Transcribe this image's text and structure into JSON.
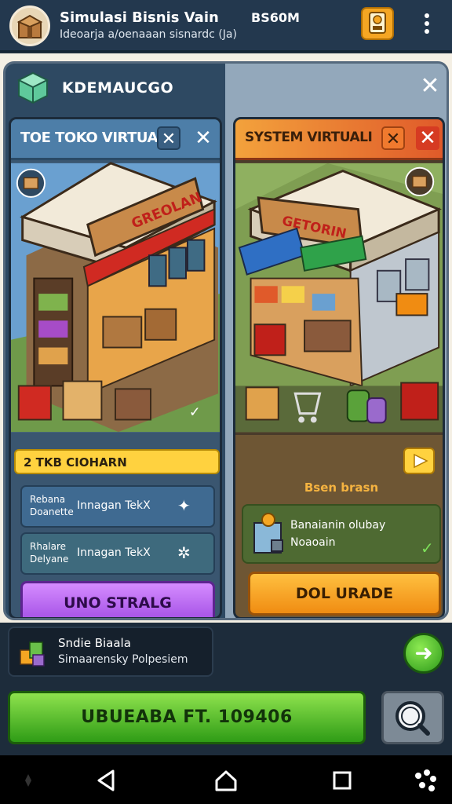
{
  "header": {
    "title": "Simulasi Bisnis Vain",
    "code": "BS60M",
    "subtitle": "Ideoarja a/oenaaan  sisnardc (Ja)",
    "app_icon": "store-box-icon",
    "profile_icon": "badge-icon",
    "menu_icon": "kebab-menu-icon"
  },
  "panel": {
    "title": "KDEMAUCGO",
    "icon": "cube-icon",
    "close_label": "✕"
  },
  "left_card": {
    "title": "TOE TOKO VIRTUAL",
    "close_box_label": "✕",
    "close_label": "✕",
    "sign_text": "GREOLAN",
    "banner": "2 TKB CIOHARN",
    "options": [
      {
        "label_line1": "Rebana",
        "label_line2": "Doanette",
        "text": "Innagan TekX",
        "icon": "sparkle-icon",
        "icon_glyph": "✦"
      },
      {
        "label_line1": "Rhalare",
        "label_line2": "Delyane",
        "text": "Innagan TekX",
        "icon": "star-icon",
        "icon_glyph": "✲"
      }
    ],
    "button": "UNO STRALG"
  },
  "right_card": {
    "title": "SYSTEM VIRTUALI",
    "close_box_label": "✕",
    "close_label": "✕",
    "sign_text": "GETORIN",
    "subtitle": "Bsen brasn",
    "info_line1": "Banaianin olubay",
    "info_line2": "Noaoain",
    "check": "✓",
    "button": "DOL URADE"
  },
  "notification": {
    "title": "Sndie Biaala",
    "subtitle": "Simaarensky Polpesiem"
  },
  "next_button_glyph": "➜",
  "main_button": "UBUEABA FT. 109406",
  "colors": {
    "accent_green": "#5cc232",
    "accent_orange": "#f5a623",
    "accent_purple": "#b66cf0",
    "banner_yellow": "#ffd23f"
  }
}
